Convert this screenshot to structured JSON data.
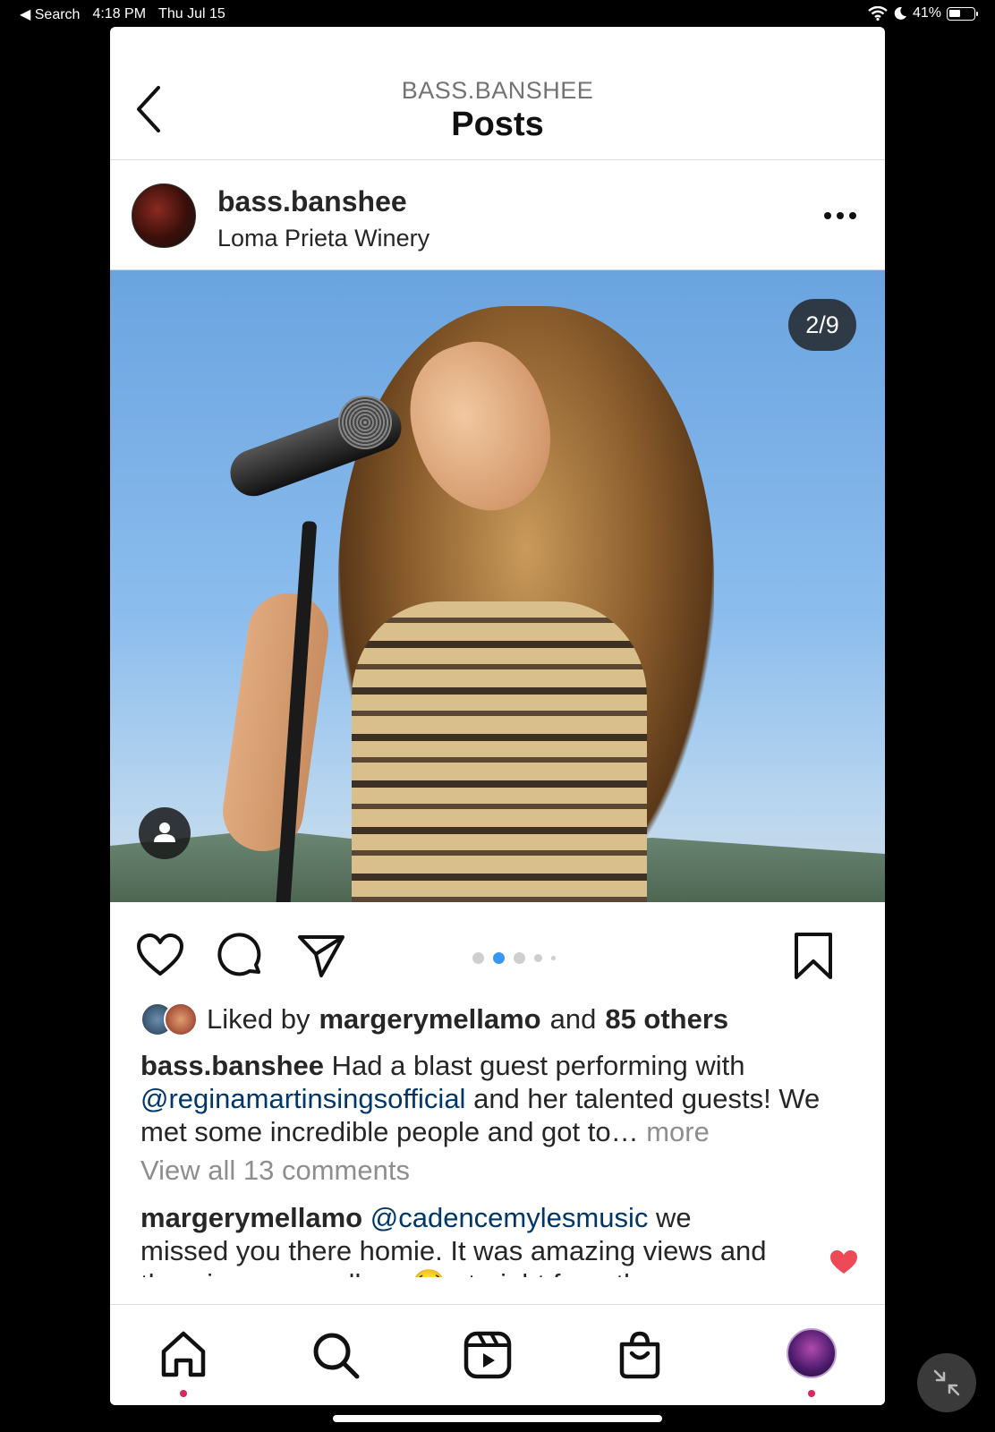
{
  "status_bar": {
    "back_app": "◀ Search",
    "time": "4:18 PM",
    "date": "Thu Jul 15",
    "battery": "41%"
  },
  "header": {
    "subtitle": "BASS.BANSHEE",
    "title": "Posts"
  },
  "post": {
    "username": "bass.banshee",
    "location": "Loma Prieta Winery",
    "counter": "2/9",
    "carousel_active_index": 1,
    "carousel_dots": 5
  },
  "likes": {
    "prefix": "Liked by",
    "user": "margerymellamo",
    "and": "and",
    "others": "85 others"
  },
  "caption": {
    "username": "bass.banshee",
    "text_1": "Had a blast guest performing with",
    "mention": "@reginamartinsingsofficial",
    "text_2": "and her talented guests! We met some incredible people and got to…",
    "more": "more"
  },
  "view_all": "View all 13 comments",
  "comment": {
    "username": "margerymellamo",
    "mention": "@cadencemylesmusic",
    "text": "we missed you there homie. It was amazing views and the wine was endless 😂 straight from the"
  },
  "colors": {
    "accent_blue": "#3897f0",
    "link_blue": "#00376b",
    "like_red": "#ed4956"
  }
}
